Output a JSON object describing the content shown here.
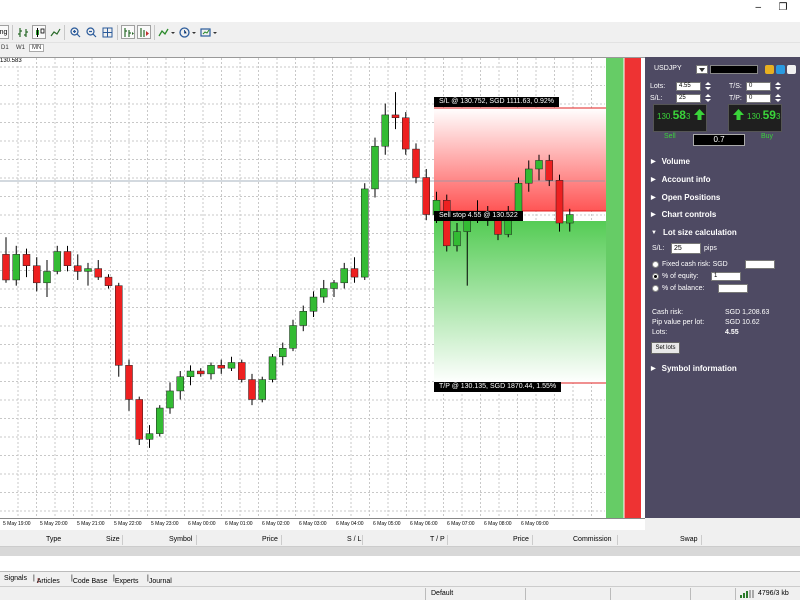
{
  "titlebar": {
    "minimize": "–",
    "restore": "❐"
  },
  "toolbar": {
    "tab_fragment": "ng"
  },
  "timeframes": [
    "D1",
    "W1",
    "MN"
  ],
  "chart": {
    "symbol": "USDJPY",
    "price_marker": "130.583",
    "sl_label": "S/L @ 130.752, SGD 1111.63, 0.92%",
    "entry_label": "Sell stop 4.55 @ 130.522",
    "tp_label": "T/P @ 130.135, SGD 1870.44, 1.55%",
    "colors": {
      "bull": "#33bb33",
      "bear": "#ee2020",
      "sl_zone": "#ff5555",
      "tp_zone": "#55cc55"
    },
    "time_labels": [
      "5 May 19:00",
      "5 May 20:00",
      "5 May 21:00",
      "5 May 22:00",
      "5 May 23:00",
      "6 May 00:00",
      "6 May 01:00",
      "6 May 02:00",
      "6 May 03:00",
      "6 May 04:00",
      "6 May 05:00",
      "6 May 06:00",
      "6 May 07:00",
      "6 May 08:00",
      "6 May 09:00"
    ],
    "candles": [
      [
        130.515,
        130.545,
        130.465,
        130.47
      ],
      [
        130.47,
        130.53,
        130.46,
        130.515
      ],
      [
        130.515,
        130.525,
        130.475,
        130.495
      ],
      [
        130.495,
        130.51,
        130.45,
        130.465
      ],
      [
        130.465,
        130.505,
        130.44,
        130.485
      ],
      [
        130.485,
        130.53,
        130.48,
        130.52
      ],
      [
        130.52,
        130.53,
        130.485,
        130.495
      ],
      [
        130.495,
        130.515,
        130.47,
        130.485
      ],
      [
        130.485,
        130.5,
        130.46,
        130.49
      ],
      [
        130.49,
        130.505,
        130.47,
        130.475
      ],
      [
        130.475,
        130.48,
        130.455,
        130.46
      ],
      [
        130.46,
        130.465,
        130.3,
        130.32
      ],
      [
        130.32,
        130.33,
        130.24,
        130.26
      ],
      [
        130.26,
        130.265,
        130.18,
        130.19
      ],
      [
        130.19,
        130.215,
        130.175,
        130.2
      ],
      [
        130.2,
        130.25,
        130.195,
        130.245
      ],
      [
        130.245,
        130.29,
        130.235,
        130.275
      ],
      [
        130.275,
        130.31,
        130.26,
        130.3
      ],
      [
        130.3,
        130.32,
        130.285,
        130.31
      ],
      [
        130.31,
        130.315,
        130.3,
        130.305
      ],
      [
        130.305,
        130.325,
        130.295,
        130.32
      ],
      [
        130.32,
        130.33,
        130.305,
        130.315
      ],
      [
        130.315,
        130.335,
        130.31,
        130.325
      ],
      [
        130.325,
        130.33,
        130.29,
        130.295
      ],
      [
        130.295,
        130.305,
        130.25,
        130.26
      ],
      [
        130.26,
        130.3,
        130.255,
        130.295
      ],
      [
        130.295,
        130.34,
        130.29,
        130.335
      ],
      [
        130.335,
        130.36,
        130.32,
        130.35
      ],
      [
        130.35,
        130.4,
        130.345,
        130.39
      ],
      [
        130.39,
        130.425,
        130.38,
        130.415
      ],
      [
        130.415,
        130.45,
        130.405,
        130.44
      ],
      [
        130.44,
        130.47,
        130.43,
        130.455
      ],
      [
        130.455,
        130.47,
        130.44,
        130.465
      ],
      [
        130.465,
        130.5,
        130.455,
        130.49
      ],
      [
        130.49,
        130.51,
        130.465,
        130.475
      ],
      [
        130.475,
        130.64,
        130.47,
        130.63
      ],
      [
        130.63,
        130.72,
        130.615,
        130.705
      ],
      [
        130.705,
        130.78,
        130.69,
        130.76
      ],
      [
        130.76,
        130.8,
        130.735,
        130.755
      ],
      [
        130.755,
        130.765,
        130.69,
        130.7
      ],
      [
        130.7,
        130.71,
        130.64,
        130.65
      ],
      [
        130.65,
        130.665,
        130.575,
        130.585
      ],
      [
        130.585,
        130.625,
        130.57,
        130.61
      ],
      [
        130.61,
        130.62,
        130.52,
        130.53
      ],
      [
        130.53,
        130.57,
        130.52,
        130.555
      ],
      [
        130.555,
        130.59,
        130.46,
        130.58
      ],
      [
        130.58,
        130.61,
        130.57,
        130.59
      ],
      [
        130.59,
        130.6,
        130.565,
        130.575
      ],
      [
        130.575,
        130.59,
        130.54,
        130.55
      ],
      [
        130.55,
        130.6,
        130.545,
        130.59
      ],
      [
        130.59,
        130.65,
        130.58,
        130.64
      ],
      [
        130.64,
        130.68,
        130.625,
        130.665
      ],
      [
        130.665,
        130.69,
        130.645,
        130.68
      ],
      [
        130.68,
        130.69,
        130.635,
        130.645
      ],
      [
        130.645,
        130.655,
        130.555,
        130.57
      ],
      [
        130.57,
        130.595,
        130.555,
        130.585
      ]
    ]
  },
  "panel": {
    "symbol": "USDJPY",
    "lots_label": "Lots:",
    "lots_value": "4.55",
    "sl_label": "S/L:",
    "sl_value": "25",
    "ts_label": "T/S:",
    "ts_value": "0",
    "tp_label": "T/P:",
    "tp_value": "0",
    "sell_price_prefix": "130.",
    "sell_price_big": "58",
    "sell_price_small": "3",
    "buy_price_prefix": "130.",
    "buy_price_big": "59",
    "buy_price_small": "3",
    "sell_label": "Sell",
    "buy_label": "Buy",
    "spread": "0.7",
    "sections": {
      "volume": "Volume",
      "account_info": "Account info",
      "open_positions": "Open Positions",
      "chart_controls": "Chart controls",
      "lot_size": "Lot size calculation",
      "symbol_info": "Symbol information"
    },
    "calc": {
      "sl_label": "S/L:",
      "sl_value": "25",
      "pips": "pips",
      "fixed_cash_label": "Fixed cash risk: SGD",
      "equity_label": "% of equity:",
      "equity_value": "1",
      "balance_label": "% of balance:",
      "cash_risk_label": "Cash risk:",
      "cash_risk_value": "SGD 1,208.63",
      "pip_value_label": "Pip value per lot:",
      "pip_value_value": "SGD 10.62",
      "lots_label": "Lots:",
      "lots_value": "4.55",
      "set_lots": "Set lots"
    }
  },
  "terminal": {
    "columns": [
      "Type",
      "Size",
      "Symbol",
      "Price",
      "S / L",
      "T / P",
      "Price",
      "Commission",
      "Swap"
    ],
    "tabs": [
      "Signals",
      "Articles",
      "Code Base",
      "Experts",
      "Journal"
    ],
    "articles_badge": "2"
  },
  "status": {
    "profile": "Default",
    "traffic": "4796/3 kb"
  }
}
